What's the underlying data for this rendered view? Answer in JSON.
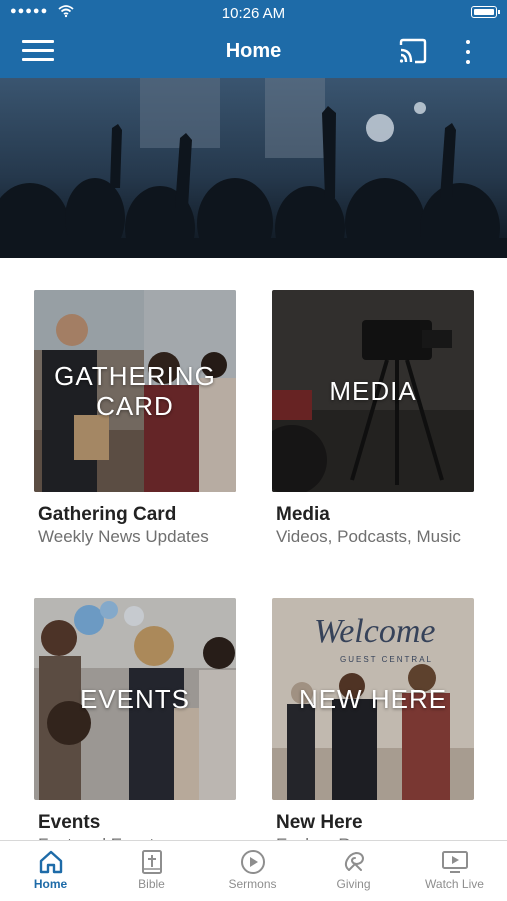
{
  "status_bar": {
    "time": "10:26 AM",
    "signal": "●●●●●"
  },
  "navbar": {
    "title": "Home"
  },
  "cards": [
    {
      "overlay": "GATHERING CARD",
      "title": "Gathering Card",
      "subtitle": "Weekly News Updates"
    },
    {
      "overlay": "MEDIA",
      "title": "Media",
      "subtitle": "Videos, Podcasts, Music"
    },
    {
      "overlay": "EVENTS",
      "title": "Events",
      "subtitle": "Featured Events"
    },
    {
      "overlay": "NEW HERE",
      "title": "New Here",
      "subtitle": "Explore Resources"
    }
  ],
  "new_here_image": {
    "sign_script": "Welcome",
    "sign_small": "GUEST CENTRAL"
  },
  "tabbar": {
    "tabs": [
      {
        "label": "Home",
        "active": true
      },
      {
        "label": "Bible",
        "active": false
      },
      {
        "label": "Sermons",
        "active": false
      },
      {
        "label": "Giving",
        "active": false
      },
      {
        "label": "Watch Live",
        "active": false
      }
    ]
  },
  "colors": {
    "brand": "#1e6ba8",
    "inactive": "#8e8e8e"
  }
}
